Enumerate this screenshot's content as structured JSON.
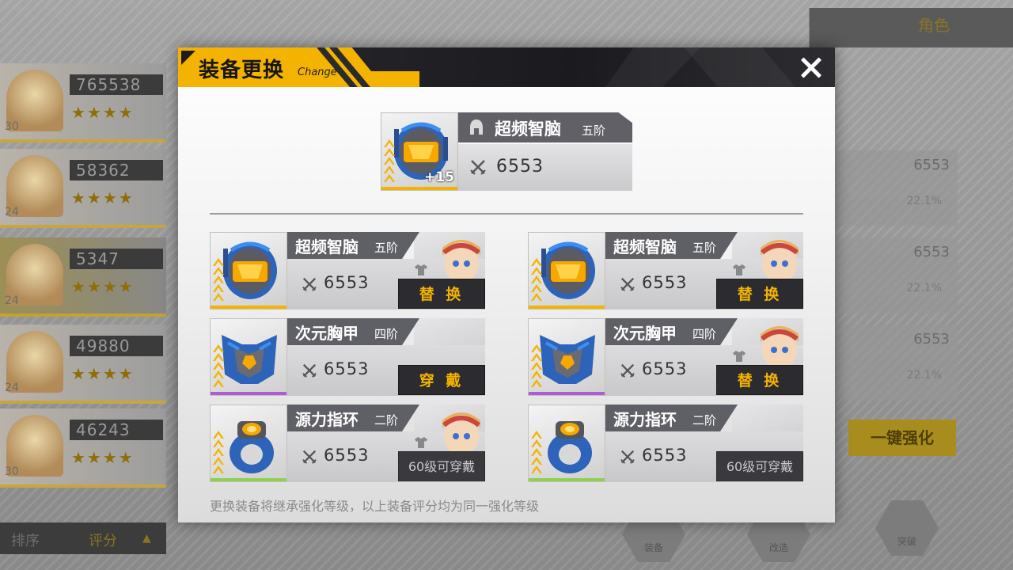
{
  "background": {
    "roster": [
      {
        "power": "765538",
        "level": "30"
      },
      {
        "power": "58362",
        "level": "24"
      },
      {
        "power": "5347",
        "level": "24"
      },
      {
        "power": "49880",
        "level": "24"
      },
      {
        "power": "46243",
        "level": "30"
      }
    ],
    "sort_label": "排序",
    "sort_value": "评分",
    "top_right_label": "角色",
    "right_stats": [
      {
        "value": "6553",
        "pct": "22.1%"
      },
      {
        "value": "6553",
        "pct": "22.1%"
      },
      {
        "value": "6553",
        "pct": "22.1%"
      }
    ],
    "one_click_label": "一键强化",
    "hex_buttons": [
      "装备",
      "改造",
      "突破"
    ]
  },
  "modal": {
    "title": "装备更换",
    "subtitle": "Change",
    "current": {
      "name": "超频智脑",
      "tier": "五阶",
      "power": "6553",
      "plus": "+15",
      "icon": "helmet-icon"
    },
    "cards": [
      {
        "name": "超频智脑",
        "tier": "五阶",
        "power": "6553",
        "action": "替 换",
        "rarity_color": "#f4b300",
        "item_icon": "helmet-icon",
        "has_portrait": true
      },
      {
        "name": "超频智脑",
        "tier": "五阶",
        "power": "6553",
        "action": "替 换",
        "rarity_color": "#f4b300",
        "item_icon": "helmet-icon",
        "has_portrait": true
      },
      {
        "name": "次元胸甲",
        "tier": "四阶",
        "power": "6553",
        "action": "穿 戴",
        "rarity_color": "#b05ad6",
        "item_icon": "chest-armor-icon",
        "has_portrait": false
      },
      {
        "name": "次元胸甲",
        "tier": "四阶",
        "power": "6553",
        "action": "替 换",
        "rarity_color": "#b05ad6",
        "item_icon": "chest-armor-icon",
        "has_portrait": true
      },
      {
        "name": "源力指环",
        "tier": "二阶",
        "power": "6553",
        "action": "60级可穿戴",
        "rarity_color": "#8fd14f",
        "item_icon": "ring-icon",
        "has_portrait": true
      },
      {
        "name": "源力指环",
        "tier": "二阶",
        "power": "6553",
        "action": "60级可穿戴",
        "rarity_color": "#8fd14f",
        "item_icon": "ring-icon",
        "has_portrait": false
      }
    ],
    "footnote": "更换装备将继承强化等级，以上装备评分均为同一强化等级"
  }
}
